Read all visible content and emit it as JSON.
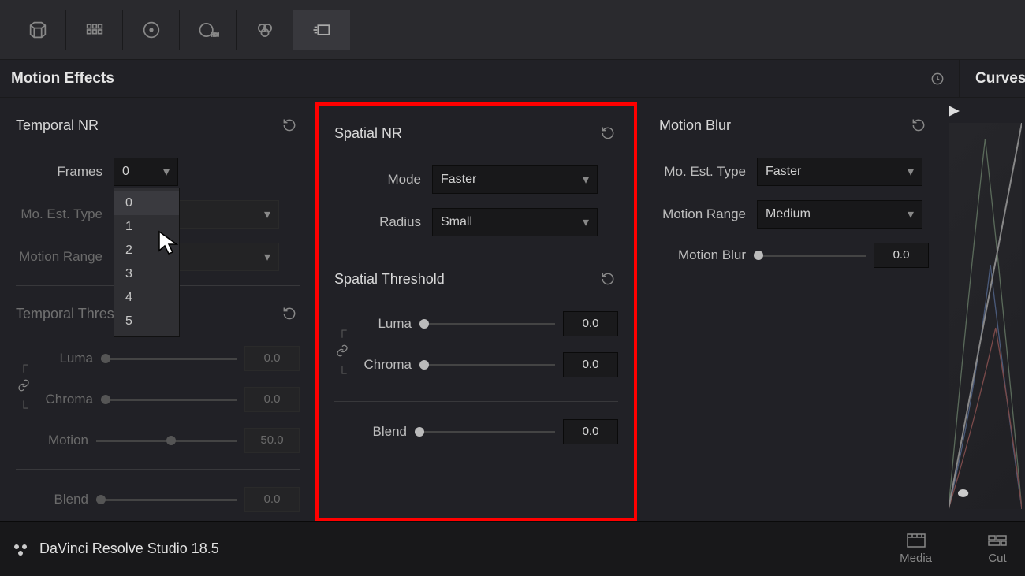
{
  "header": {
    "title": "Motion Effects",
    "side_title": "Curves"
  },
  "temporal": {
    "title": "Temporal NR",
    "frames_label": "Frames",
    "frames_value": "0",
    "frames_options": [
      "0",
      "1",
      "2",
      "3",
      "4",
      "5"
    ],
    "mo_est_label": "Mo. Est. Type",
    "mo_est_value": "",
    "range_label": "Motion Range",
    "range_value": "",
    "threshold_title": "Temporal Threshold",
    "luma_label": "Luma",
    "luma_value": "0.0",
    "chroma_label": "Chroma",
    "chroma_value": "0.0",
    "motion_label": "Motion",
    "motion_value": "50.0",
    "blend_label": "Blend",
    "blend_value": "0.0"
  },
  "spatial": {
    "title": "Spatial NR",
    "mode_label": "Mode",
    "mode_value": "Faster",
    "radius_label": "Radius",
    "radius_value": "Small",
    "threshold_title": "Spatial Threshold",
    "luma_label": "Luma",
    "luma_value": "0.0",
    "chroma_label": "Chroma",
    "chroma_value": "0.0",
    "blend_label": "Blend",
    "blend_value": "0.0"
  },
  "motionblur": {
    "title": "Motion Blur",
    "mo_est_label": "Mo. Est. Type",
    "mo_est_value": "Faster",
    "range_label": "Motion Range",
    "range_value": "Medium",
    "blur_label": "Motion Blur",
    "blur_value": "0.0"
  },
  "footer": {
    "app_name": "DaVinci Resolve Studio 18.5",
    "tabs": {
      "media": "Media",
      "cut": "Cut"
    }
  }
}
